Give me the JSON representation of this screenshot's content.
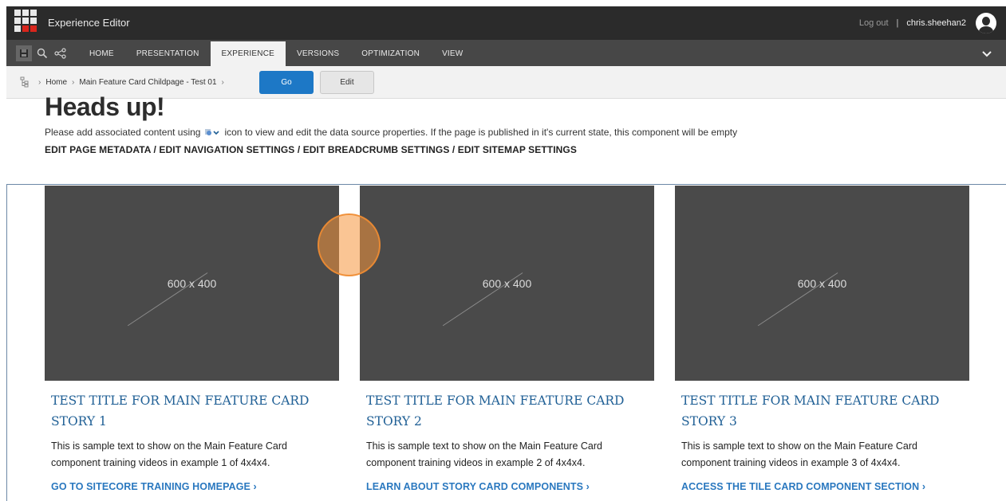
{
  "topbar": {
    "app_title": "Experience Editor",
    "logout": "Log out",
    "separator": "|",
    "username": "chris.sheehan2"
  },
  "ribbon": {
    "tabs": [
      {
        "label": "HOME"
      },
      {
        "label": "PRESENTATION"
      },
      {
        "label": "EXPERIENCE"
      },
      {
        "label": "VERSIONS"
      },
      {
        "label": "OPTIMIZATION"
      },
      {
        "label": "VIEW"
      }
    ],
    "active_tab": "EXPERIENCE"
  },
  "breadcrumb": {
    "items": [
      {
        "label": "Home"
      },
      {
        "label": "Main Feature Card Childpage - Test 01"
      }
    ],
    "go_label": "Go",
    "edit_label": "Edit"
  },
  "notice": {
    "heading": "Heads up!",
    "text_before": "Please add associated content using",
    "text_after": "icon to view and edit the data source properties. If the page is published in it's current state, this component will be empty",
    "meta_links": "EDIT PAGE METADATA / EDIT NAVIGATION SETTINGS / EDIT BREADCRUMB SETTINGS / EDIT SITEMAP SETTINGS"
  },
  "cards": [
    {
      "image_label": "600 x 400",
      "title": "TEST TITLE FOR MAIN FEATURE CARD STORY 1",
      "text": "This is sample text to show on the Main Feature Card component training videos in example 1 of 4x4x4.",
      "link": "GO TO SITECORE TRAINING HOMEPAGE ›"
    },
    {
      "image_label": "600 x 400",
      "title": "TEST TITLE FOR MAIN FEATURE CARD STORY 2",
      "text": "This is sample text to show on the Main Feature Card component training videos in example 2 of 4x4x4.",
      "link": "LEARN ABOUT STORY CARD COMPONENTS ›"
    },
    {
      "image_label": "600 x 400",
      "title": "TEST TITLE FOR MAIN FEATURE CARD STORY 3",
      "text": "This is sample text to show on the Main Feature Card component training videos in example 3 of 4x4x4.",
      "link": "ACCESS THE TILE CARD COMPONENT SECTION ›"
    }
  ],
  "colors": {
    "topbar": "#2b2b2b",
    "ribbon": "#474747",
    "go_button": "#1d78c6",
    "card_title": "#1f5f95",
    "card_link": "#2a78bf",
    "placeholder": "#4a4a4a",
    "click_indicator": "#f5963c"
  },
  "icons": {
    "logo": "sitecore-grid-logo",
    "save": "save-icon",
    "search": "search-icon",
    "share": "share-icon",
    "chevron": "chevron-down-icon",
    "tree": "tree-icon",
    "data_source": "data-source-icon",
    "avatar": "user-avatar"
  }
}
